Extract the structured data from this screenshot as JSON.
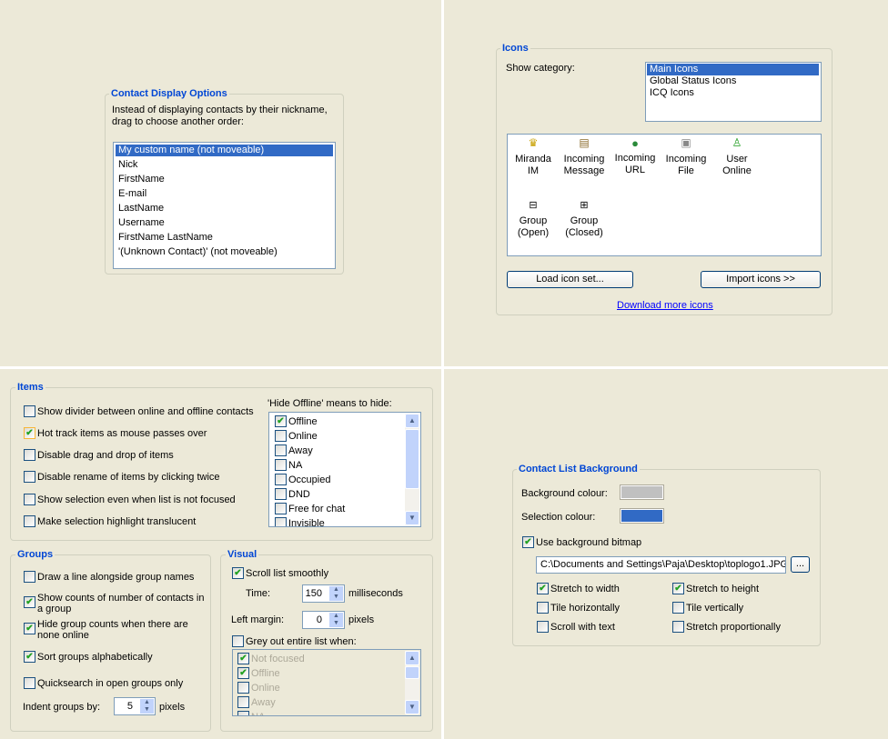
{
  "contact_display": {
    "title": "Contact Display Options",
    "desc1": "Instead of displaying contacts by their nickname,",
    "desc2": "drag to choose another order:",
    "items": [
      "My custom name (not moveable)",
      "Nick",
      "FirstName",
      "E-mail",
      "LastName",
      "Username",
      "FirstName LastName",
      "'(Unknown Contact)' (not moveable)"
    ]
  },
  "icons": {
    "title": "Icons",
    "show_category": "Show category:",
    "categories": [
      "Main Icons",
      "Global Status Icons",
      "ICQ Icons"
    ],
    "items": [
      {
        "l1": "Miranda",
        "l2": "IM",
        "icon": "miranda-icon"
      },
      {
        "l1": "Incoming",
        "l2": "Message",
        "icon": "message-icon"
      },
      {
        "l1": "Incoming",
        "l2": "URL",
        "icon": "globe-icon"
      },
      {
        "l1": "Incoming",
        "l2": "File",
        "icon": "floppy-icon"
      },
      {
        "l1": "User",
        "l2": "Online",
        "icon": "user-online-icon"
      },
      {
        "l1": "Group",
        "l2": "(Open)",
        "icon": "minus-box-icon"
      },
      {
        "l1": "Group",
        "l2": "(Closed)",
        "icon": "plus-box-icon"
      }
    ],
    "load_button": "Load icon set...",
    "import_button": "Import icons >>",
    "download_link": "Download more icons"
  },
  "items": {
    "title": "Items",
    "options": [
      {
        "label": "Show divider between online and offline contacts",
        "checked": false
      },
      {
        "label": "Hot track items as mouse passes over",
        "checked": true
      },
      {
        "label": "Disable drag and drop of items",
        "checked": false
      },
      {
        "label": "Disable rename of items by clicking twice",
        "checked": false
      },
      {
        "label": "Show selection even when list is not focused",
        "checked": false
      },
      {
        "label": "Make selection highlight translucent",
        "checked": false
      }
    ],
    "hide_offline_label": "'Hide Offline' means to hide:",
    "hide_list": [
      {
        "label": "Offline",
        "checked": true
      },
      {
        "label": "Online",
        "checked": false
      },
      {
        "label": "Away",
        "checked": false
      },
      {
        "label": "NA",
        "checked": false
      },
      {
        "label": "Occupied",
        "checked": false
      },
      {
        "label": "DND",
        "checked": false
      },
      {
        "label": "Free for chat",
        "checked": false
      },
      {
        "label": "Invisible",
        "checked": false
      }
    ]
  },
  "groups": {
    "title": "Groups",
    "options": [
      {
        "label": "Draw a line alongside group names",
        "checked": false
      },
      {
        "label": "Show counts of number of contacts in",
        "label2": "a group",
        "checked": true
      },
      {
        "label": "Hide group counts when there are",
        "label2": "none online",
        "checked": true
      },
      {
        "label": "Sort groups alphabetically",
        "checked": true
      },
      {
        "label": "Quicksearch in open groups only",
        "checked": false
      }
    ],
    "indent_label": "Indent groups by:",
    "indent_value": "5",
    "indent_unit": "pixels"
  },
  "visual": {
    "title": "Visual",
    "scroll_smoothly": "Scroll list smoothly",
    "time_label": "Time:",
    "time_value": "150",
    "time_unit": "milliseconds",
    "margin_label": "Left margin:",
    "margin_value": "0",
    "margin_unit": "pixels",
    "grey_out": "Grey out entire list when:",
    "grey_list": [
      {
        "label": "Not focused",
        "checked": true
      },
      {
        "label": "Offline",
        "checked": true
      },
      {
        "label": "Online",
        "checked": false
      },
      {
        "label": "Away",
        "checked": false
      },
      {
        "label": "NA",
        "checked": false
      }
    ]
  },
  "background": {
    "title": "Contact List Background",
    "bg_label": "Background colour:",
    "bg_color": "#C0C0C0",
    "sel_label": "Selection colour:",
    "sel_color": "#316AC5",
    "use_bitmap": "Use background bitmap",
    "path": "C:\\Documents and Settings\\Paja\\Desktop\\toplogo1.JPG",
    "browse": "...",
    "options": [
      {
        "label": "Stretch to width",
        "checked": true
      },
      {
        "label": "Stretch to height",
        "checked": true
      },
      {
        "label": "Tile horizontally",
        "checked": false
      },
      {
        "label": "Tile vertically",
        "checked": false
      },
      {
        "label": "Scroll with text",
        "checked": false
      },
      {
        "label": "Stretch proportionally",
        "checked": false
      }
    ]
  }
}
